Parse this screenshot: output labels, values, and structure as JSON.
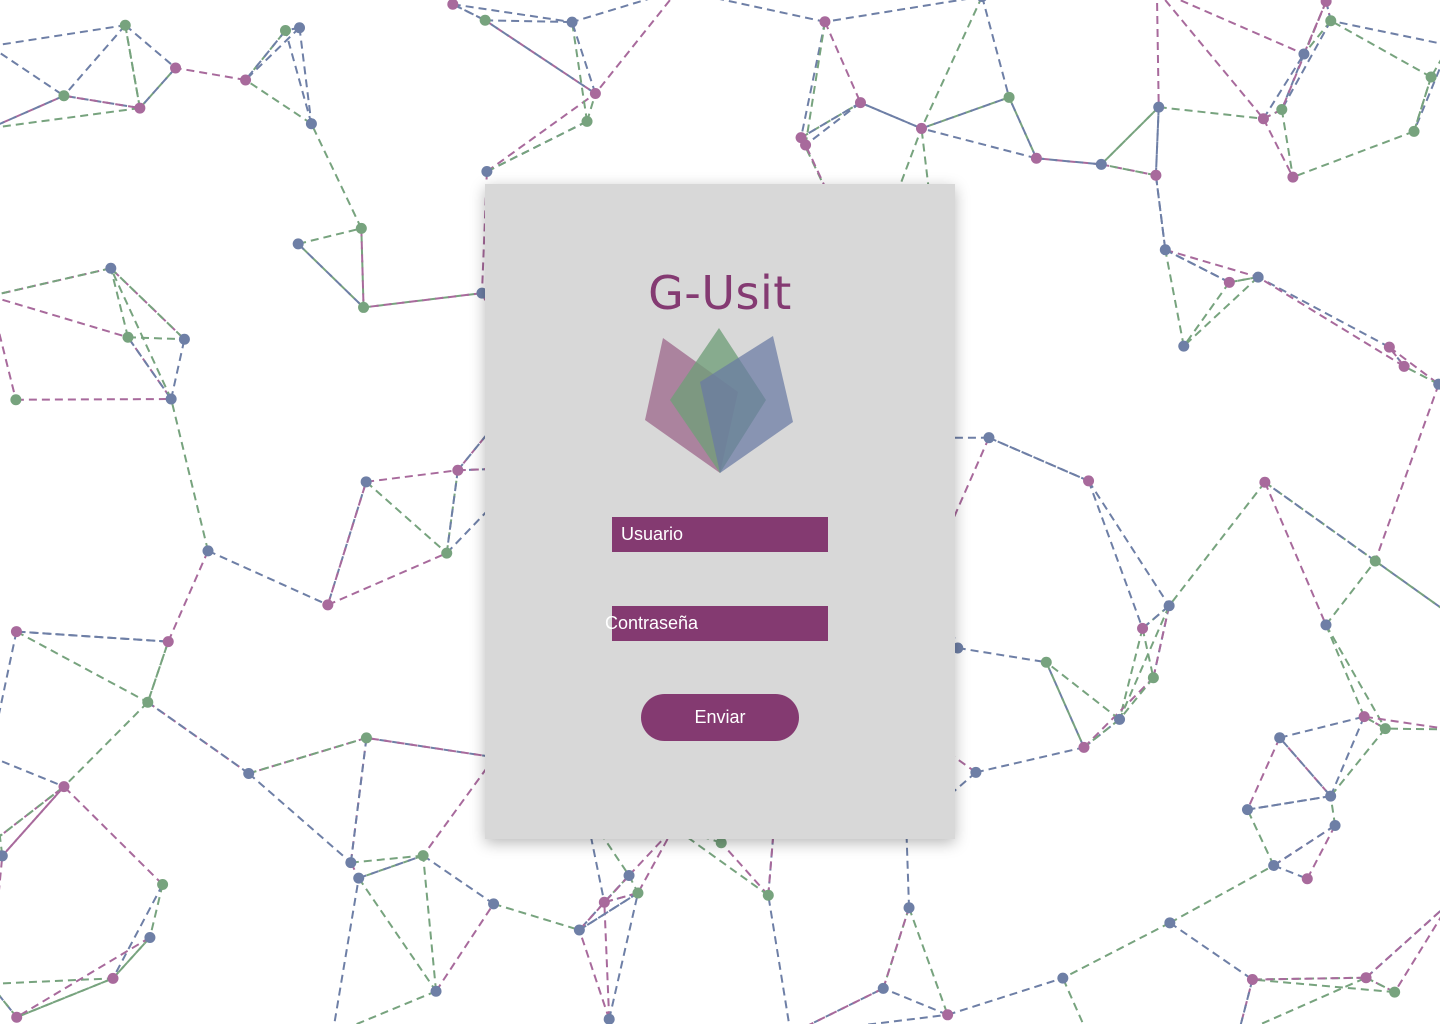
{
  "app": {
    "title": "G-Usit"
  },
  "form": {
    "username_placeholder": "Usuario",
    "password_placeholder": "Contraseña",
    "submit_label": "Enviar"
  },
  "colors": {
    "brand": "#843a71",
    "card_background": "#d8d8d8",
    "network_purple": "#a86a9c",
    "network_green": "#77a37e",
    "network_blue": "#6e7fa6"
  },
  "icons": {
    "logo": "lotus-petals-logo"
  }
}
